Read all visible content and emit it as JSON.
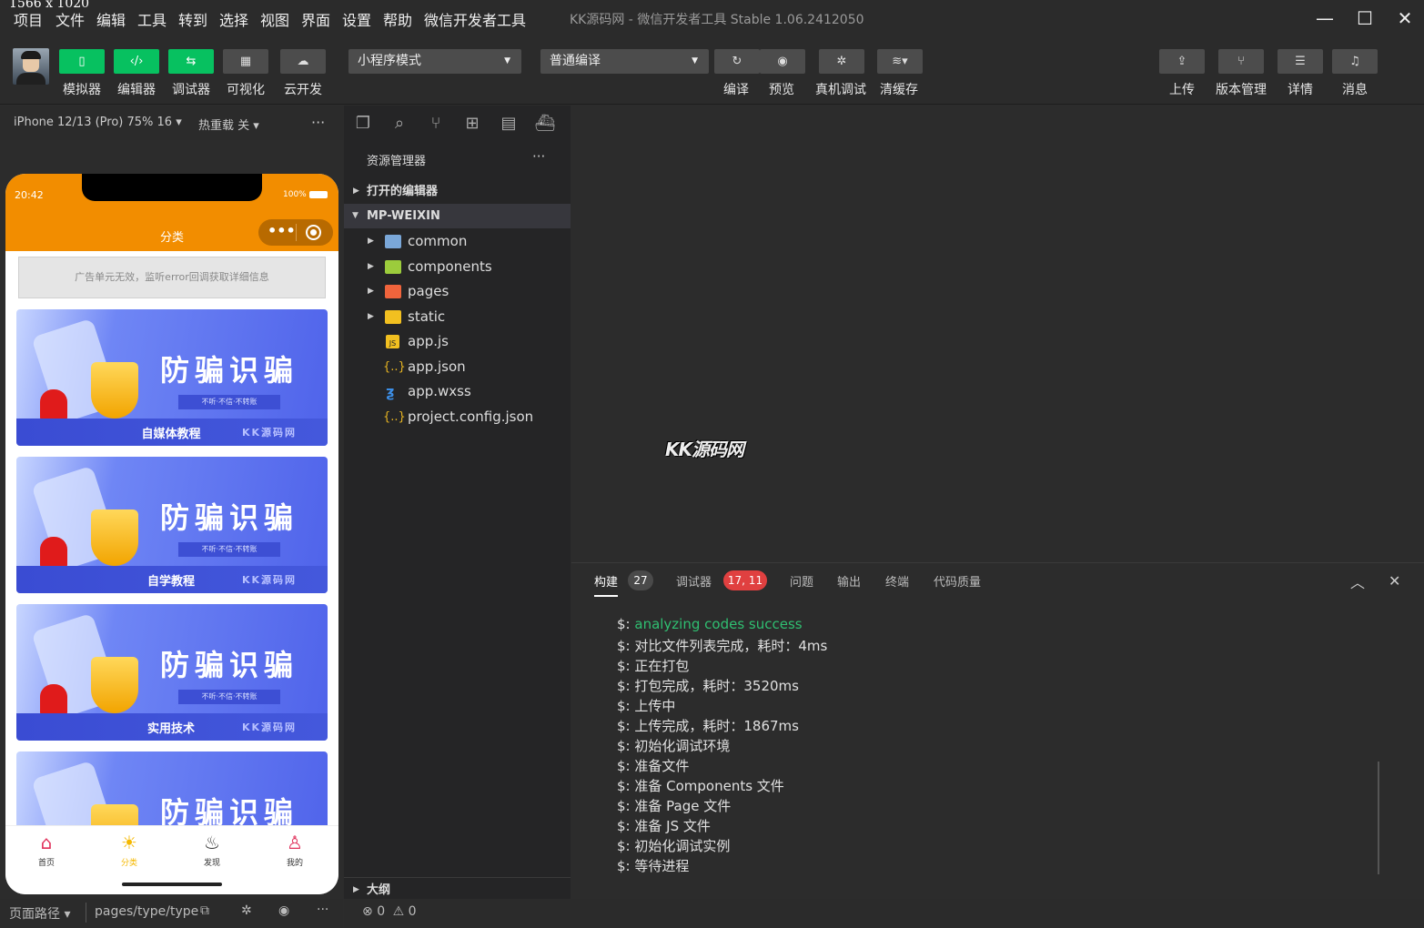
{
  "titlebar": {
    "size_note": "1566 x 1020",
    "menu": [
      "项目",
      "文件",
      "编辑",
      "工具",
      "转到",
      "选择",
      "视图",
      "界面",
      "设置",
      "帮助",
      "微信开发者工具"
    ],
    "window_title": "KK源码网 - 微信开发者工具 Stable 1.06.2412050",
    "controls": [
      "—",
      "☐",
      "✕"
    ]
  },
  "toolbar": {
    "left_buttons": [
      {
        "label": "模拟器",
        "icon": "phone-icon"
      },
      {
        "label": "编辑器",
        "icon": "code-icon"
      },
      {
        "label": "调试器",
        "icon": "debug-icon"
      },
      {
        "label": "可视化",
        "icon": "layout-icon"
      },
      {
        "label": "云开发",
        "icon": "cloud-icon"
      }
    ],
    "mode_select": "小程序模式",
    "compile_select": "普通编译",
    "mid_buttons": [
      {
        "label": "编译",
        "icon": "refresh-icon"
      },
      {
        "label": "预览",
        "icon": "eye-icon"
      },
      {
        "label": "真机调试",
        "icon": "bug-icon"
      },
      {
        "label": "清缓存",
        "icon": "layers-icon"
      }
    ],
    "right_buttons": [
      {
        "label": "上传",
        "icon": "upload-icon"
      },
      {
        "label": "版本管理",
        "icon": "branch-icon"
      },
      {
        "label": "详情",
        "icon": "menu-icon"
      },
      {
        "label": "消息",
        "icon": "bell-icon"
      }
    ]
  },
  "simulator": {
    "device": "iPhone 12/13 (Pro) 75% 16",
    "hot_reload": "热重载 关",
    "more": "···",
    "phone": {
      "time": "20:42",
      "battery": "100%",
      "nav_title": "分类",
      "ad_text": "广告单元无效，监听error回调获取详细信息",
      "cards": [
        {
          "title": "防骗识骗",
          "sub": "不听·不信·不转账",
          "label": "自媒体教程",
          "brand": "KK源码网"
        },
        {
          "title": "防骗识骗",
          "sub": "不听·不信·不转账",
          "label": "自学教程",
          "brand": "KK源码网"
        },
        {
          "title": "防骗识骗",
          "sub": "不听·不信·不转账",
          "label": "实用技术",
          "brand": "KK源码网"
        },
        {
          "title": "防骗识骗",
          "sub": "",
          "label": "",
          "brand": ""
        }
      ],
      "tabs": [
        {
          "label": "首页",
          "icon": "home-icon",
          "color": "#e0305a"
        },
        {
          "label": "分类",
          "icon": "sun-icon",
          "color": "#f5b800"
        },
        {
          "label": "发现",
          "icon": "bulb-icon",
          "color": "#333333"
        },
        {
          "label": "我的",
          "icon": "user-icon",
          "color": "#e0305a"
        }
      ]
    },
    "footer": {
      "route_label": "页面路径",
      "route": "pages/type/type"
    }
  },
  "explorer": {
    "title": "资源管理器",
    "more": "···",
    "open_editors": "打开的编辑器",
    "root": "MP-WEIXIN",
    "items": [
      {
        "name": "common",
        "kind": "folder",
        "color": "#7aa7d8"
      },
      {
        "name": "components",
        "kind": "folder",
        "color": "#9ccc3c"
      },
      {
        "name": "pages",
        "kind": "folder",
        "color": "#f0643c"
      },
      {
        "name": "static",
        "kind": "folder",
        "color": "#f2c020"
      },
      {
        "name": "app.js",
        "kind": "js",
        "color": "#f2c020"
      },
      {
        "name": "app.json",
        "kind": "json",
        "color": "#e6b422"
      },
      {
        "name": "app.wxss",
        "kind": "css",
        "color": "#3c8ee6"
      },
      {
        "name": "project.config.json",
        "kind": "json",
        "color": "#e6b422"
      }
    ],
    "outline": "大纲",
    "errors": "0",
    "warnings": "0"
  },
  "editor": {
    "watermark": "KK源码网"
  },
  "panel": {
    "tabs": [
      {
        "label": "构建",
        "badge": "27"
      },
      {
        "label": "调试器",
        "badge": "17, 11"
      },
      {
        "label": "问题",
        "badge": ""
      },
      {
        "label": "输出",
        "badge": ""
      },
      {
        "label": "终端",
        "badge": ""
      },
      {
        "label": "代码质量",
        "badge": ""
      }
    ],
    "logs": [
      {
        "prefix": "$: ",
        "text": "analyzing codes success",
        "color": "#2fbf71"
      },
      {
        "prefix": "$: ",
        "text": "对比文件列表完成，耗时：4ms",
        "color": "#e0e0e0"
      },
      {
        "prefix": "$: ",
        "text": "正在打包",
        "color": "#e0e0e0"
      },
      {
        "prefix": "$: ",
        "text": "打包完成，耗时：3520ms",
        "color": "#e0e0e0"
      },
      {
        "prefix": "$: ",
        "text": "上传中",
        "color": "#e0e0e0"
      },
      {
        "prefix": "$: ",
        "text": "上传完成，耗时：1867ms",
        "color": "#e0e0e0"
      },
      {
        "prefix": "$: ",
        "text": "初始化调试环境",
        "color": "#e0e0e0"
      },
      {
        "prefix": "$: ",
        "text": "准备文件",
        "color": "#e0e0e0"
      },
      {
        "prefix": "$: ",
        "text": "准备 Components 文件",
        "color": "#e0e0e0"
      },
      {
        "prefix": "$: ",
        "text": "准备 Page 文件",
        "color": "#e0e0e0"
      },
      {
        "prefix": "$: ",
        "text": "准备 JS 文件",
        "color": "#e0e0e0"
      },
      {
        "prefix": "$: ",
        "text": "初始化调试实例",
        "color": "#e0e0e0"
      },
      {
        "prefix": "$: ",
        "text": "等待进程",
        "color": "#e0e0e0"
      }
    ]
  },
  "colors": {
    "accent_green": "#07c160",
    "phone_orange": "#f28d00",
    "error_badge": "#e04040"
  }
}
